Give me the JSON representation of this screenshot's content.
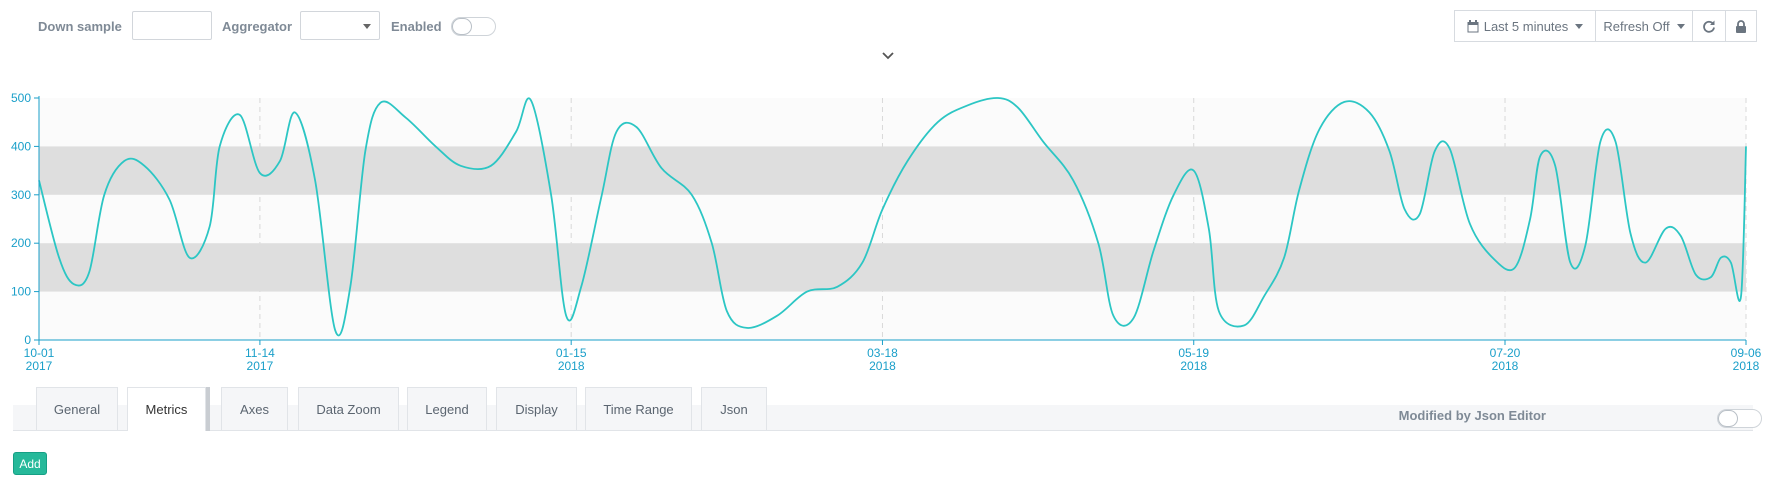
{
  "toolbar": {
    "down_sample_label": "Down sample",
    "down_sample_value": "",
    "aggregator_label": "Aggregator",
    "aggregator_value": "",
    "enabled_label": "Enabled",
    "enabled_on": false,
    "time_range_label": "Last 5 minutes",
    "refresh_label": "Refresh Off",
    "icons": [
      "calendar-icon",
      "refresh-icon",
      "lock-icon"
    ]
  },
  "colors": {
    "series": "#2cc6c4",
    "axis": "#1a9fc9",
    "band": "#dedede",
    "accent_green": "#26b99a"
  },
  "chart_data": {
    "type": "line",
    "smooth": true,
    "ylim": [
      0,
      500
    ],
    "yticks": [
      "0",
      "100",
      "200",
      "300",
      "400",
      "500"
    ],
    "xticks": [
      {
        "date": "10-01",
        "year": "2017"
      },
      {
        "date": "11-14",
        "year": "2017"
      },
      {
        "date": "01-15",
        "year": "2018"
      },
      {
        "date": "03-18",
        "year": "2018"
      },
      {
        "date": "05-19",
        "year": "2018"
      },
      {
        "date": "07-20",
        "year": "2018"
      },
      {
        "date": "09-06",
        "year": "2018"
      }
    ],
    "bands": [
      [
        100,
        200
      ],
      [
        300,
        400
      ]
    ],
    "grid_vertical": true,
    "x_start": "2017-10-01",
    "x_end": "2018-09-06",
    "points": [
      [
        "2017-10-01",
        330
      ],
      [
        "2017-10-05",
        170
      ],
      [
        "2017-10-08",
        115
      ],
      [
        "2017-10-11",
        140
      ],
      [
        "2017-10-14",
        300
      ],
      [
        "2017-10-18",
        370
      ],
      [
        "2017-10-22",
        360
      ],
      [
        "2017-10-27",
        290
      ],
      [
        "2017-10-31",
        170
      ],
      [
        "2017-11-04",
        235
      ],
      [
        "2017-11-06",
        400
      ],
      [
        "2017-11-10",
        465
      ],
      [
        "2017-11-14",
        345
      ],
      [
        "2017-11-18",
        370
      ],
      [
        "2017-11-21",
        470
      ],
      [
        "2017-11-25",
        330
      ],
      [
        "2017-11-29",
        20
      ],
      [
        "2017-12-02",
        110
      ],
      [
        "2017-12-05",
        390
      ],
      [
        "2017-12-08",
        490
      ],
      [
        "2017-12-13",
        460
      ],
      [
        "2017-12-19",
        400
      ],
      [
        "2017-12-24",
        360
      ],
      [
        "2017-12-30",
        360
      ],
      [
        "2018-01-04",
        430
      ],
      [
        "2018-01-07",
        495
      ],
      [
        "2018-01-11",
        300
      ],
      [
        "2018-01-14",
        50
      ],
      [
        "2018-01-17",
        110
      ],
      [
        "2018-01-21",
        295
      ],
      [
        "2018-01-24",
        430
      ],
      [
        "2018-01-28",
        440
      ],
      [
        "2018-02-02",
        355
      ],
      [
        "2018-02-08",
        300
      ],
      [
        "2018-02-12",
        200
      ],
      [
        "2018-02-15",
        60
      ],
      [
        "2018-02-19",
        25
      ],
      [
        "2018-02-25",
        50
      ],
      [
        "2018-03-03",
        100
      ],
      [
        "2018-03-09",
        110
      ],
      [
        "2018-03-14",
        160
      ],
      [
        "2018-03-18",
        270
      ],
      [
        "2018-03-23",
        370
      ],
      [
        "2018-03-29",
        450
      ],
      [
        "2018-04-04",
        485
      ],
      [
        "2018-04-10",
        500
      ],
      [
        "2018-04-14",
        480
      ],
      [
        "2018-04-19",
        410
      ],
      [
        "2018-04-25",
        330
      ],
      [
        "2018-04-30",
        200
      ],
      [
        "2018-05-03",
        50
      ],
      [
        "2018-05-07",
        45
      ],
      [
        "2018-05-11",
        185
      ],
      [
        "2018-05-15",
        300
      ],
      [
        "2018-05-19",
        350
      ],
      [
        "2018-05-22",
        230
      ],
      [
        "2018-05-24",
        60
      ],
      [
        "2018-05-29",
        30
      ],
      [
        "2018-06-02",
        90
      ],
      [
        "2018-06-06",
        170
      ],
      [
        "2018-06-09",
        310
      ],
      [
        "2018-06-13",
        435
      ],
      [
        "2018-06-18",
        492
      ],
      [
        "2018-06-23",
        470
      ],
      [
        "2018-06-27",
        390
      ],
      [
        "2018-06-30",
        270
      ],
      [
        "2018-07-03",
        260
      ],
      [
        "2018-07-06",
        390
      ],
      [
        "2018-07-09",
        395
      ],
      [
        "2018-07-13",
        240
      ],
      [
        "2018-07-18",
        165
      ],
      [
        "2018-07-22",
        150
      ],
      [
        "2018-07-25",
        250
      ],
      [
        "2018-07-27",
        380
      ],
      [
        "2018-07-30",
        360
      ],
      [
        "2018-08-02",
        160
      ],
      [
        "2018-08-05",
        195
      ],
      [
        "2018-08-08",
        410
      ],
      [
        "2018-08-11",
        410
      ],
      [
        "2018-08-14",
        220
      ],
      [
        "2018-08-17",
        160
      ],
      [
        "2018-08-21",
        230
      ],
      [
        "2018-08-24",
        215
      ],
      [
        "2018-08-27",
        135
      ],
      [
        "2018-08-30",
        130
      ],
      [
        "2018-09-01",
        170
      ],
      [
        "2018-09-03",
        160
      ],
      [
        "2018-09-05",
        90
      ],
      [
        "2018-09-06",
        400
      ]
    ]
  },
  "tabs": [
    {
      "label": "General",
      "active": false
    },
    {
      "label": "Metrics",
      "active": true
    },
    {
      "label": "Axes",
      "active": false
    },
    {
      "label": "Data Zoom",
      "active": false
    },
    {
      "label": "Legend",
      "active": false
    },
    {
      "label": "Display",
      "active": false
    },
    {
      "label": "Time Range",
      "active": false
    },
    {
      "label": "Json",
      "active": false
    }
  ],
  "json_editor": {
    "label": "Modified by Json Editor",
    "enabled": false
  },
  "add_button_label": "Add"
}
